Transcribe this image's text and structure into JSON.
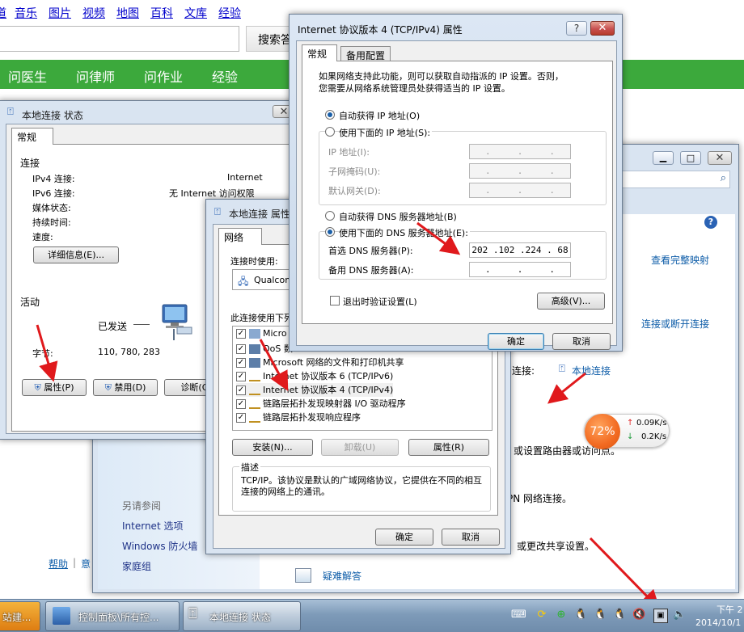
{
  "browser": {
    "nav_cut": "道",
    "nav": [
      "音乐",
      "图片",
      "视频",
      "地图",
      "百科",
      "文库",
      "经验"
    ],
    "search_button": "搜索答",
    "green_menu": [
      "问医生",
      "问律师",
      "问作业",
      "经验"
    ]
  },
  "status_window": {
    "title": "本地连接 状态",
    "tab": "常规",
    "section_connection": "连接",
    "ipv4_label": "IPv4 连接:",
    "ipv4_value": "Internet",
    "ipv6_label": "IPv6 连接:",
    "ipv6_value": "无 Internet 访问权限",
    "media_state_label": "媒体状态:",
    "duration_label": "持续时间:",
    "speed_label": "速度:",
    "details_button": "详细信息(E)...",
    "section_activity": "活动",
    "sent_label": "已发送",
    "bytes_label": "字节:",
    "bytes_sent": "110, 780, 283",
    "properties_button": "属性(P)",
    "disable_button": "禁用(D)",
    "diagnose_button": "诊断(G)"
  },
  "control_panel": {
    "link_full_map": "查看完整映射",
    "link_connect_disconnect": "连接或断开连接",
    "access_type_label": "连接:",
    "local_connection_link": "本地连接",
    "text_router": "或设置路由器或访问点。",
    "text_vpn": "PN 网络连接。",
    "text_sharing": "或更改共享设置。",
    "troubleshoot": "疑难解答",
    "see_also": "另请参阅",
    "see_also_items": [
      "Internet 选项",
      "Windows 防火墙",
      "家庭组"
    ],
    "help_link": "帮助",
    "help_sep": "|",
    "help_cut": "意"
  },
  "speed_widget": {
    "percent": "72%",
    "up": "0.09K/s",
    "down": "0.2K/s"
  },
  "props_window": {
    "title": "本地连接 属性",
    "tab": "网络",
    "connect_using_label": "连接时使用:",
    "adapter_name": "Qualcom",
    "items_label": "此连接使用下列",
    "items": [
      {
        "label": "Micro",
        "checked": true,
        "icon": "network-client-icon"
      },
      {
        "label": "QoS 数",
        "checked": true,
        "icon": "qos-icon"
      },
      {
        "label": "Microsoft 网络的文件和打印机共享",
        "checked": true,
        "icon": "file-sharing-icon"
      },
      {
        "label": "Internet 协议版本 6 (TCP/IPv6)",
        "checked": true,
        "icon": "protocol-icon"
      },
      {
        "label": "Internet 协议版本 4 (TCP/IPv4)",
        "checked": true,
        "icon": "protocol-icon"
      },
      {
        "label": "链路层拓扑发现映射器 I/O 驱动程序",
        "checked": true,
        "icon": "protocol-icon"
      },
      {
        "label": "链路层拓扑发现响应程序",
        "checked": true,
        "icon": "protocol-icon"
      }
    ],
    "install_button": "安装(N)...",
    "uninstall_button": "卸载(U)",
    "properties_button": "属性(R)",
    "description_label": "描述",
    "description_text": "TCP/IP。该协议是默认的广域网络协议，它提供在不同的相互连接的网络上的通讯。",
    "ok_button": "确定",
    "cancel_button": "取消"
  },
  "ipv4_window": {
    "title": "Internet 协议版本 4 (TCP/IPv4) 属性",
    "help_glyph": "?",
    "close_glyph": "✕",
    "tab_general": "常规",
    "tab_alternate": "备用配置",
    "intro_line1": "如果网络支持此功能，则可以获取自动指派的 IP 设置。否则，",
    "intro_line2": "您需要从网络系统管理员处获得适当的 IP 设置。",
    "auto_ip": "自动获得 IP 地址(O)",
    "use_ip": "使用下面的 IP 地址(S):",
    "ip_label": "IP 地址(I):",
    "mask_label": "子网掩码(U):",
    "gateway_label": "默认网关(D):",
    "empty_ip": ".     .     .",
    "auto_dns": "自动获得 DNS 服务器地址(B)",
    "use_dns": "使用下面的 DNS 服务器地址(E):",
    "preferred_dns_label": "首选 DNS 服务器(P):",
    "preferred_dns_value": "202 .102 .224 . 68",
    "alternate_dns_label": "备用 DNS 服务器(A):",
    "validate_label": "退出时验证设置(L)",
    "advanced_button": "高级(V)...",
    "ok_button": "确定",
    "cancel_button": "取消"
  },
  "taskbar": {
    "start_label": "站建...",
    "items": [
      "控制面板\\所有控...",
      "本地连接 状态"
    ],
    "time_line1": "下午 2",
    "time_line2": "2014/10/1"
  },
  "colors": {
    "green_bar": "#3ca93c",
    "link_blue": "#0d5ca8",
    "arrow_red": "#e0191c",
    "speed_orange": "#f26a21"
  }
}
